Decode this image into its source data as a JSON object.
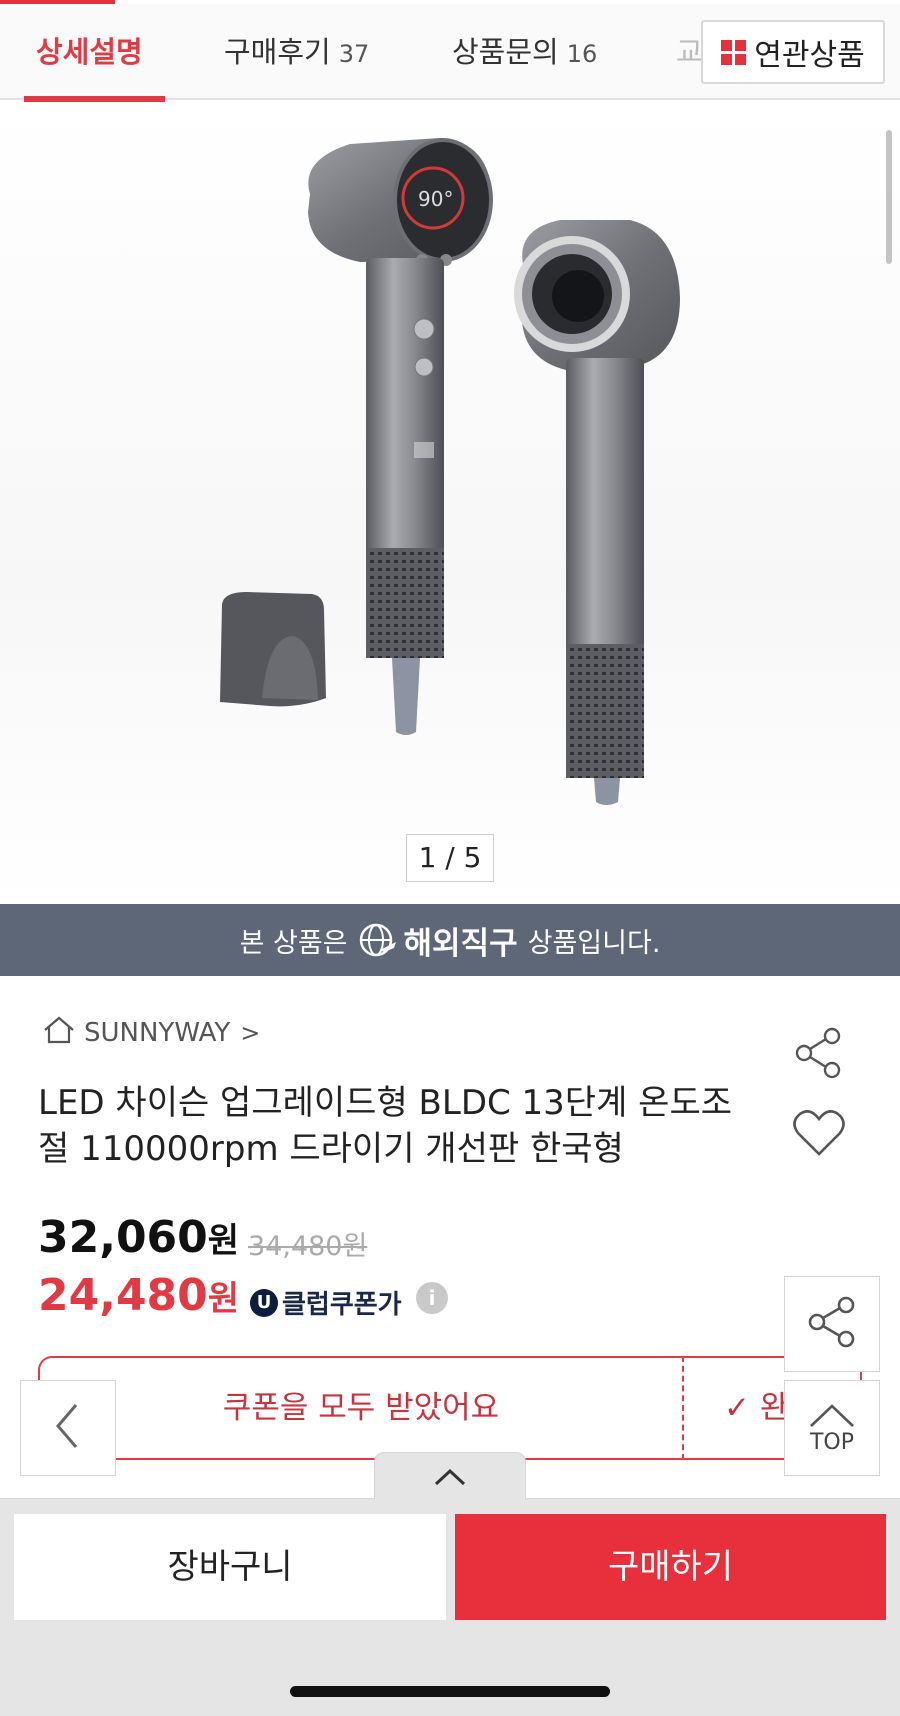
{
  "tabs": [
    {
      "label": "상세설명",
      "count": ""
    },
    {
      "label": "구매후기",
      "count": "37"
    },
    {
      "label": "상품문의",
      "count": "16"
    }
  ],
  "tab_cut_fragment": "교",
  "related_button": "연관상품",
  "image_pager": "1 / 5",
  "banner": {
    "prefix": "본 상품은",
    "highlight": "해외직구",
    "suffix": "상품입니다."
  },
  "store": {
    "name": "SUNNYWAY",
    "chevron": ">"
  },
  "product_title": "LED 차이슨 업그레이드형 BLDC 13단계 온도조절 110000rpm 드라이기 개선판 한국형",
  "price": {
    "amount": "32,060",
    "unit": "원",
    "original": "34,480원"
  },
  "coupon_price": {
    "amount": "24,480",
    "unit": "원",
    "badge_letter": "U",
    "badge_label": "클럽쿠폰가",
    "info": "i"
  },
  "coupon_button": "쿠폰을 모두 받았어요",
  "coupon_done": "✓ 완료",
  "float": {
    "top_label": "TOP"
  },
  "cart_button": "장바구니",
  "buy_button": "구매하기",
  "colors": {
    "accent": "#e8303d",
    "banner": "#5d6778",
    "club": "#0f1d3d"
  },
  "icons": [
    "grid-icon",
    "globe-plane-icon",
    "home-icon",
    "share-icon",
    "heart-icon",
    "chevron-left-icon",
    "chevron-up-icon",
    "info-icon"
  ]
}
